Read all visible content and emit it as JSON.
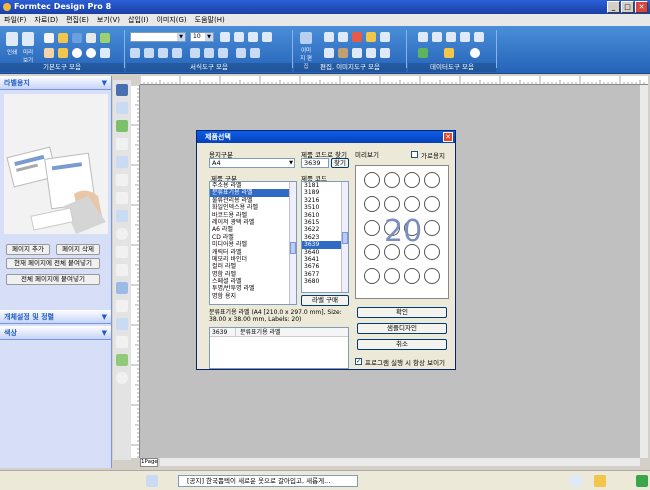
{
  "app": {
    "title": "Formtec Design Pro 8"
  },
  "window_buttons": {
    "min": "_",
    "max": "□",
    "close": "✕"
  },
  "menu": [
    "파일(F)",
    "자료(D)",
    "편집(E)",
    "보기(V)",
    "삽입(I)",
    "이미지(G)",
    "도움말(H)"
  ],
  "toolbar": {
    "groups": [
      "기본도구 모음",
      "서식도구 모음",
      "편집, 이미지도구 모음",
      "데이터도구 모음"
    ],
    "big_buttons": {
      "new": "인쇄",
      "template": "미리보기",
      "image_edit": "이미지 편집"
    },
    "font_size": "10",
    "font_name": ""
  },
  "left_panel": {
    "header": "라벨용지",
    "buttons": {
      "add_page": "페이지 추가",
      "delete_page": "페이지 삭제",
      "paste_current": "현재 페이지에 전체 붙여넣기",
      "paste_all": "전체 페이지에 붙여넣기"
    },
    "sections": [
      "개체설정 및 정렬",
      "색상"
    ]
  },
  "page_tab": "1Page",
  "status": {
    "notice": "[공지] 한국폼텍이 새로운 옷으로 갈아입고, 새롭게..."
  },
  "dialog": {
    "title": "제품선택",
    "paper_type_label": "용지구분",
    "paper_type_value": "A4",
    "product_type_label": "제품 구분",
    "product_types": [
      "주소용 라벨",
      "분류표기용 라벨",
      "물류관리용 라벨",
      "화일인덱스용 라벨",
      "바코드용 라벨",
      "레이저 광택 라벨",
      "A6 라벨",
      "CD 라벨",
      "미디어용 라벨",
      "캐릭터 라벨",
      "메모리 바인더",
      "컬러 라벨",
      "명함 라벨",
      "스페셜 라벨",
      "투명/반투명 라벨",
      "명함 용지"
    ],
    "product_type_selected": 1,
    "code_search_label": "제품 코드로 찾기",
    "code_search_value": "3639",
    "search_button": "찾기",
    "product_code_label": "제품 코드",
    "product_codes": [
      "3181",
      "3189",
      "3216",
      "3510",
      "3610",
      "3615",
      "3622",
      "3623",
      "3639",
      "3640",
      "3641",
      "3676",
      "3677",
      "3680"
    ],
    "product_code_selected": 8,
    "label_buy_button": "라벨 구매",
    "preview_label": "미리보기",
    "landscape_label": "가로용지",
    "preview_number": "20",
    "info_text": "분류표기용 라벨 (A4 [210.0 x 297.0 mm], Size: 38.00 x 38.00 mm, Labels: 20)",
    "table": {
      "col1": "3639",
      "col2": "분류표기용 라벨"
    },
    "ok_button": "확인",
    "design_button": "샘플디자인",
    "cancel_button": "취소",
    "startup_label": "프로그램 실행 시 항상 보이기",
    "startup_checked": true
  }
}
